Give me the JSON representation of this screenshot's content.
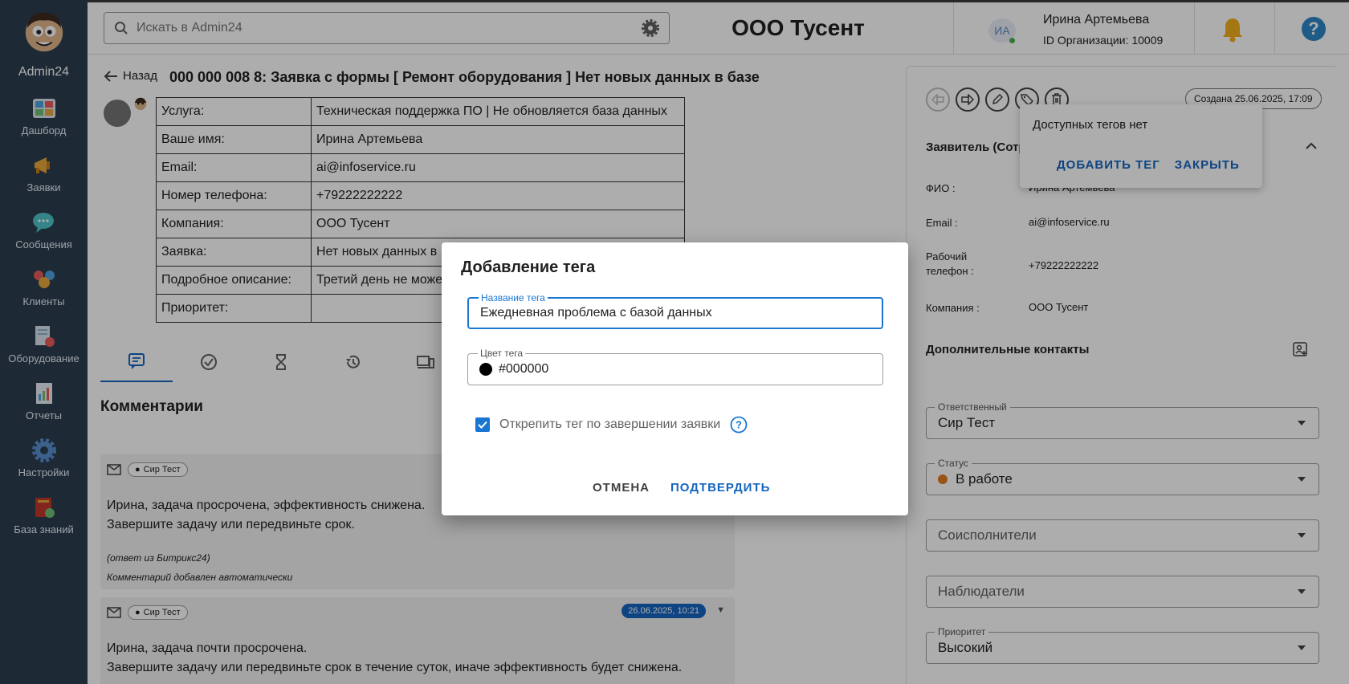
{
  "sidebar": {
    "brand": "Admin24",
    "items": [
      {
        "label": "Дашборд",
        "icon": "dashboard-icon",
        "color": "#4fa3e0"
      },
      {
        "label": "Заявки",
        "icon": "megaphone-icon",
        "color": "#e8a73a"
      },
      {
        "label": "Сообщения",
        "icon": "chat-icon",
        "color": "#4fc3c9"
      },
      {
        "label": "Клиенты",
        "icon": "clients-icon",
        "color": "#e85a5a"
      },
      {
        "label": "Оборудование",
        "icon": "equipment-icon",
        "color": "#8fb3c9"
      },
      {
        "label": "Отчеты",
        "icon": "reports-icon",
        "color": "#6fbf73"
      },
      {
        "label": "Настройки",
        "icon": "gear-icon",
        "color": "#5a8fd0"
      },
      {
        "label": "База знаний",
        "icon": "knowledge-base-icon",
        "color": "#c0392b"
      }
    ]
  },
  "header": {
    "search_placeholder": "Искать в Admin24",
    "org_title": "ООО Тусент",
    "avatar_initials": "ИА",
    "user_name": "Ирина Артемьева",
    "org_id": "ID Организации: 10009"
  },
  "request": {
    "back_label": "Назад",
    "title": "000 000 008   8: Заявка с формы [ Ремонт оборудования ] Нет новых данных в базе",
    "rows": [
      {
        "key": "Услуга:",
        "value": "Техническая поддержка ПО | Не обновляется база данных"
      },
      {
        "key": "Ваше имя:",
        "value": "Ирина Артемьева"
      },
      {
        "key": "Email:",
        "value": "ai@infoservice.ru"
      },
      {
        "key": "Номер телефона:",
        "value": "+79222222222"
      },
      {
        "key": "Компания:",
        "value": "ООО Тусент"
      },
      {
        "key": "Заявка:",
        "value": "Нет новых данных в"
      },
      {
        "key": "Подробное описание:",
        "value": "Третий день не може"
      },
      {
        "key": "Приоритет:",
        "value": ""
      }
    ]
  },
  "comments": {
    "title": "Комментарии",
    "items": [
      {
        "author": "Сир Тест",
        "line1": "Ирина, задача просрочена, эффективность снижена.",
        "line2": "Завершите задачу или передвиньте срок.",
        "note1": "(ответ из Битрикс24)",
        "note2": "Комментарий добавлен автоматически"
      },
      {
        "author": "Сир Тест",
        "date": "26.06.2025, 10:21",
        "line1": "Ирина, задача почти просрочена.",
        "line2": "Завершите задачу или передвиньте срок в течение суток, иначе эффективность будет снижена."
      }
    ]
  },
  "right_panel": {
    "created": "Создана 25.06.2025, 17:09",
    "applicant_title": "Заявитель (Сотр",
    "fields": [
      {
        "label": "ФИО :",
        "value": "Ирина Артемьева"
      },
      {
        "label": "Email :",
        "value": "ai@infoservice.ru"
      },
      {
        "label": "Рабочий телефон :",
        "value": "+79222222222"
      },
      {
        "label": "Компания :",
        "value": "ООО Тусент"
      }
    ],
    "extra_contacts": "Дополнительные контакты",
    "responsible": {
      "label": "Ответственный",
      "value": "Сир Тест"
    },
    "status": {
      "label": "Статус",
      "value": "В работе",
      "color": "#e37b22"
    },
    "coexecutors": {
      "placeholder": "Соисполнители"
    },
    "observers": {
      "placeholder": "Наблюдатели"
    },
    "priority": {
      "label": "Приоритет",
      "value": "Высокий"
    }
  },
  "tags_popover": {
    "empty_text": "Доступных тегов нет",
    "add_label": "ДОБАВИТЬ ТЕГ",
    "close_label": "ЗАКРЫТЬ"
  },
  "dialog": {
    "title": "Добавление тега",
    "name_label": "Название тега",
    "name_value": "Ежедневная проблема с базой данных",
    "color_label": "Цвет тега",
    "color_value": "#000000",
    "unpin_label": "Открепить тег по завершении заявки",
    "cancel_label": "ОТМЕНА",
    "confirm_label": "ПОДТВЕРДИТЬ"
  },
  "colors": {
    "sidebar_bg": "#2b3e50",
    "accent": "#1976d2",
    "status_orange": "#e37b22"
  }
}
